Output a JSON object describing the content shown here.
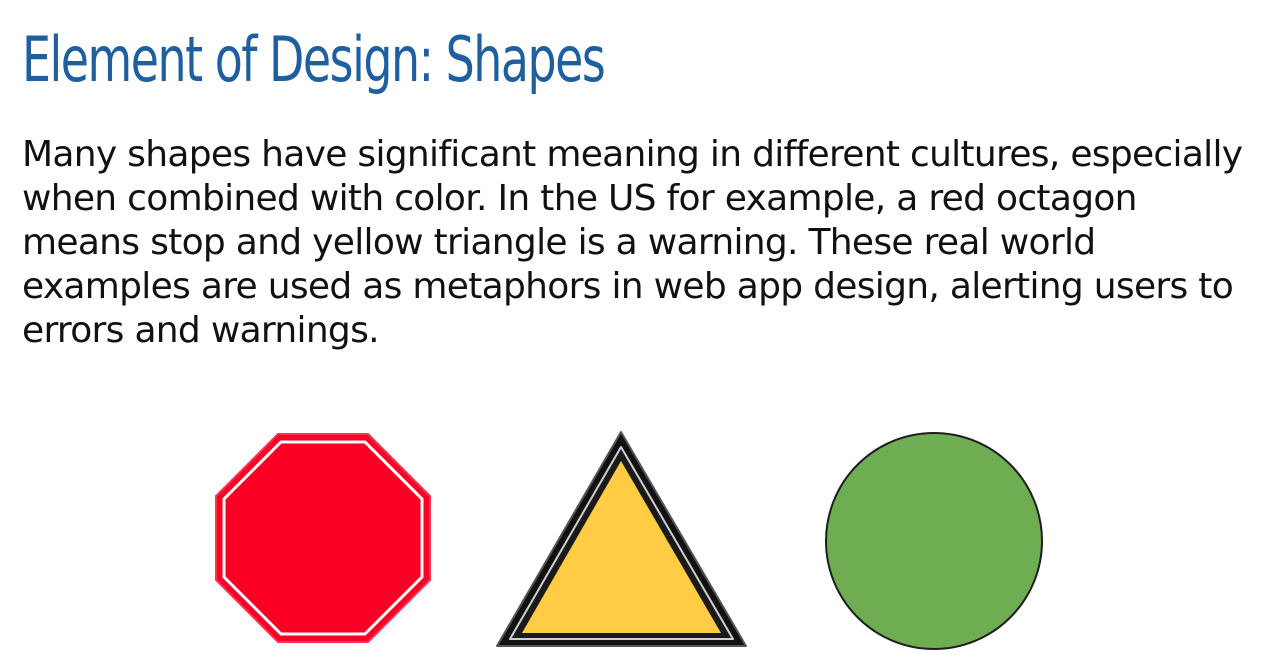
{
  "slide": {
    "title": "Element of Design: Shapes",
    "body": "Many shapes have significant meaning in different cultures, especially when combined with color. In the US for example, a red octagon means stop and yellow triangle is a warning. These real world examples are used as metaphors in web app design, alerting users to errors and warnings."
  },
  "shapes": [
    {
      "name": "octagon",
      "fill": "#fb0025",
      "border": "#ffffff"
    },
    {
      "name": "triangle",
      "fill": "#ffcc44",
      "border": "#111111"
    },
    {
      "name": "circle",
      "fill": "#6fad53",
      "border": "#1e1e1e"
    }
  ]
}
